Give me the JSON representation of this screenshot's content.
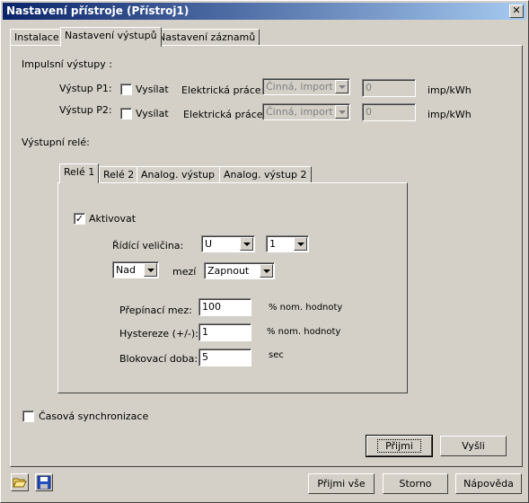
{
  "window": {
    "title": "Nastavení přístroje (Přístroj1)",
    "close": "✕"
  },
  "tabs": [
    {
      "label": "Instalace",
      "active": false
    },
    {
      "label": "Nastavení výstupů",
      "active": true
    },
    {
      "label": "Nastavení záznamů",
      "active": false
    }
  ],
  "impulse": {
    "section_label": "Impulsní výstupy :",
    "rows": [
      {
        "label": "Výstup P1:",
        "send_label": "Vysílat",
        "send_checked": false,
        "work_label": "Elektrická práce:",
        "work_value": "Činná, import",
        "value": "0",
        "unit": "imp/kWh"
      },
      {
        "label": "Výstup P2:",
        "send_label": "Vysílat",
        "send_checked": false,
        "work_label": "Elektrická práce:",
        "work_value": "Činná, import",
        "value": "0",
        "unit": "imp/kWh"
      }
    ]
  },
  "relay": {
    "section_label": "Výstupní relé:",
    "tabs": [
      {
        "label": "Relé 1",
        "active": true
      },
      {
        "label": "Relé 2",
        "active": false
      },
      {
        "label": "Analog. výstup 1",
        "active": false
      },
      {
        "label": "Analog. výstup 2",
        "active": false
      }
    ],
    "activate_label": "Aktivovat",
    "activate_checked": true,
    "control_label": "Řídící veličina:",
    "control_value": "U",
    "control_index": "1",
    "condition_value": "Nad",
    "limit_label": "mezí",
    "action_value": "Zapnout",
    "switch_label": "Přepínací mez:",
    "switch_value": "100",
    "switch_unit": "% nom. hodnoty",
    "hyst_label": "Hystereze (+/-):",
    "hyst_value": "1",
    "hyst_unit": "% nom. hodnoty",
    "block_label": "Blokovací doba:",
    "block_value": "5",
    "block_unit": "sec"
  },
  "time_sync": {
    "label": "Časová synchronizace",
    "checked": false
  },
  "buttons": {
    "accept": "Přijmi",
    "send": "Vyšli",
    "accept_all": "Přijmi vše",
    "cancel": "Storno",
    "help": "Nápověda"
  },
  "icons": {
    "open": "folder-open-icon",
    "save": "floppy-disk-icon"
  }
}
